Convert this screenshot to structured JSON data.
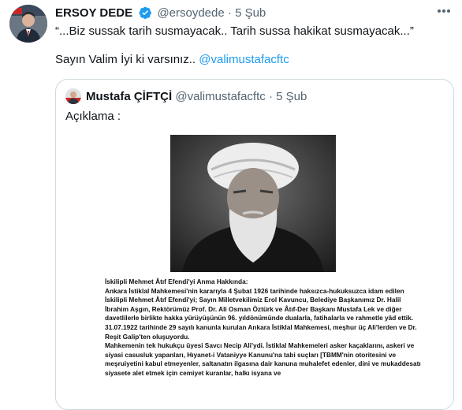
{
  "tweet": {
    "author_name": "ERSOY DEDE",
    "handle": "@ersoydede",
    "separator": "·",
    "date": "5 Şub",
    "line1": "“...Biz sussak tarih susmayacak.. Tarih sussa hakikat susmayacak...”",
    "line2_text": "Sayın Valim İyi ki varsınız.. ",
    "line2_mention": "@valimustafacftc",
    "icons": {
      "verified": "verified-badge-icon",
      "more": "more-options-icon"
    },
    "colors": {
      "link": "#1d9bf0",
      "verified": "#1d9bf0",
      "muted": "#536471"
    }
  },
  "quote": {
    "author_name": "Mustafa ÇİFTÇİ",
    "handle": "@valimustafacftc",
    "separator": "·",
    "date": "5 Şub",
    "text": "Açıklama :",
    "document": {
      "title": "İskilipli Mehmet Âtıf Efendi'yi Anma Hakkında:",
      "paragraphs": [
        "Ankara İstiklal Mahkemesi'nin kararıyla 4 Şubat 1926 tarihinde haksızca-hukuksuzca idam edilen İskilipli Mehmet Âtıf Efendi'yi; Sayın Milletvekilimiz Erol Kavuncu, Belediye Başkanımız Dr. Halil İbrahim Aşgın, Rektörümüz Prof. Dr. Ali Osman Öztürk ve Âtıf-Der Başkanı Mustafa Lek ve diğer davetlilerle birlikte hakka yürüyüşünün 96. yıldönümünde dualarla, fatihalarla ve rahmetle yâd ettik. 31.07.1922 tarihinde 29 sayılı kanunla kurulan Ankara İstiklal Mahkemesi, meşhur üç Ali'lerden ve Dr. Reşit Galip'ten oluşuyordu.",
        "Mahkemenin tek hukukçu üyesi Savcı Necip Ali'ydi. İstiklal Mahkemeleri asker kaçaklarını, askeri ve siyasi casusluk yapanları, Hıyanet-i Vataniyye Kanunu'na tabi suçları [TBMM'nin otoritesini ve meşruiyetini kabul etmeyenler, saltanatın ilgasına dair kanuna muhalefet edenler, dini ve mukaddesatı siyasete alet etmek için cemiyet kuranlar, halkı isyana ve"
      ]
    }
  }
}
